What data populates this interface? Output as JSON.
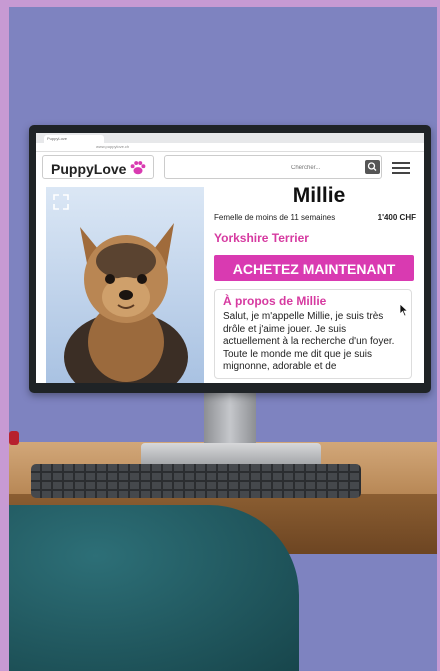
{
  "browser": {
    "tab_label": "PuppyLove",
    "url": "www.puppylove.ch"
  },
  "site": {
    "logo_text": "PuppyLove",
    "search_placeholder": "Chercher..."
  },
  "puppy": {
    "name": "Millie",
    "description": "Femelle de moins de 11 semaines",
    "price": "1'400 CHF",
    "breed": "Yorkshire Terrier",
    "buy_label": "ACHETEZ MAINTENANT",
    "about_title": "À propos de Millie",
    "about_text": "Salut, je m'appelle Millie, je suis très drôle et j'aime jouer. Je suis actuellement à la recherche d'un foyer. Toute le monde me dit que je suis mignonne, adorable et de"
  },
  "colors": {
    "accent": "#d93ab1",
    "breed_text": "#d63aa0",
    "background": "#7e83c0",
    "border": "#c79ad3"
  },
  "icons": {
    "logo": "paw-icon",
    "search": "search-icon",
    "menu": "hamburger-menu-icon",
    "photo": "expand-icon",
    "pointer": "cursor-icon"
  }
}
